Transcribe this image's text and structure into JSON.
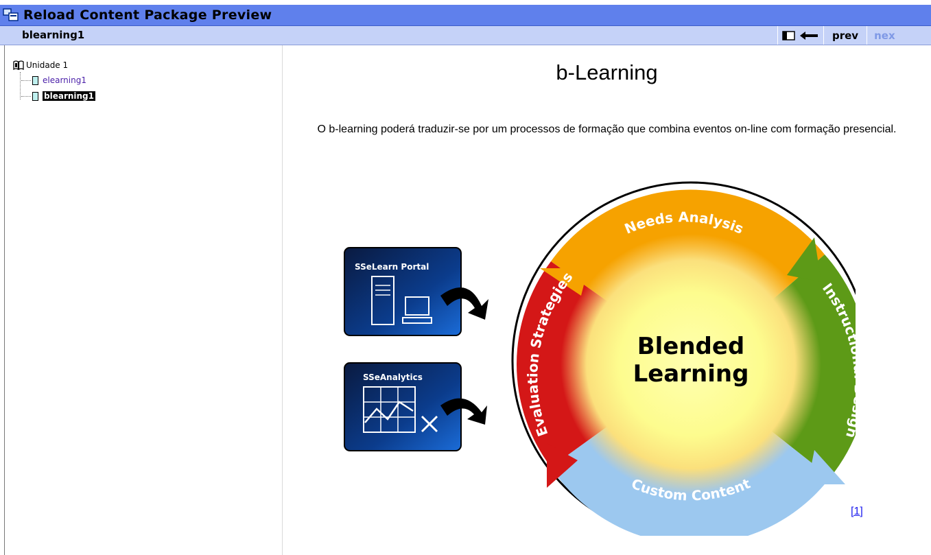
{
  "window": {
    "title": "Reload Content Package Preview",
    "icon": "package-preview-icon"
  },
  "subbar": {
    "current_item": "blearning1",
    "nav": {
      "toc_icon": "toc-toggle-icon",
      "back_icon": "arrow-left-icon",
      "prev_label": "prev",
      "next_label": "nex"
    }
  },
  "tree": {
    "root": {
      "label": "Unidade 1",
      "icon": "book-icon"
    },
    "items": [
      {
        "label": "elearning1",
        "state": "visited"
      },
      {
        "label": "blearning1",
        "state": "selected"
      }
    ]
  },
  "content": {
    "heading": "b-Learning",
    "paragraph": "O b-learning poderá traduzir-se por um processos de formação que combina eventos on-line com formação presencial.",
    "footnote": "[1]",
    "diagram": {
      "boxes": [
        "SSeLearn Portal",
        "SSeAnalytics"
      ],
      "ring_segments": [
        {
          "label": "Needs Analysis",
          "color": "#f6a200"
        },
        {
          "label": "Instructional Design",
          "color": "#5d9a17"
        },
        {
          "label": "Custom Content",
          "color": "#9cc8ef"
        },
        {
          "label": "Evaluation Strategies",
          "color": "#d41717"
        }
      ],
      "center_line1": "Blended",
      "center_line2": "Learning"
    }
  },
  "colors": {
    "title_bar": "#5f80ec",
    "sub_bar": "#c5d2f8",
    "link_visited": "#4a1fa8",
    "footnote_link": "#1a1aee"
  }
}
